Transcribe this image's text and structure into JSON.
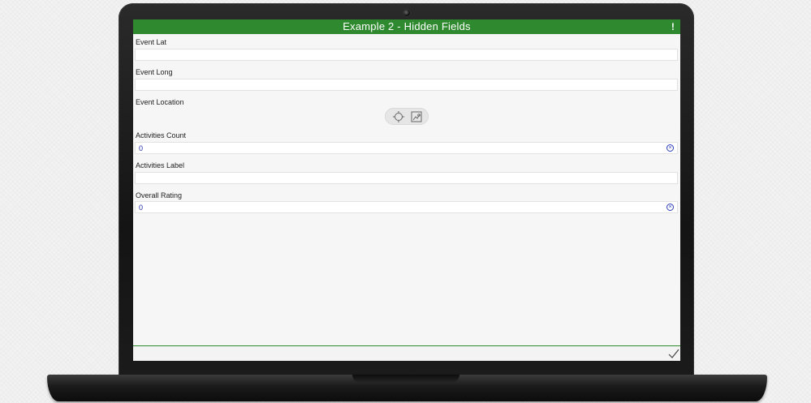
{
  "form": {
    "title": "Example 2 - Hidden Fields",
    "alert_symbol": "!",
    "fields": [
      {
        "label": "Event Lat",
        "value": "",
        "type": "text"
      },
      {
        "label": "Event Long",
        "value": "",
        "type": "text"
      },
      {
        "label": "Event Location",
        "type": "geopoint",
        "buttons": [
          "crosshair-icon",
          "map-icon"
        ]
      },
      {
        "label": "Activities Count",
        "value": "0",
        "type": "number",
        "clearable": true
      },
      {
        "label": "Activities Label",
        "value": "",
        "type": "text"
      },
      {
        "label": "Overall Rating",
        "value": "0",
        "type": "number",
        "clearable": true
      }
    ],
    "clear_symbol": "×",
    "submit_icon": "checkmark-icon"
  },
  "colors": {
    "header": "#2f8a2f",
    "value_text": "#1f2aa8",
    "screen_background": "#f5f6f5"
  }
}
